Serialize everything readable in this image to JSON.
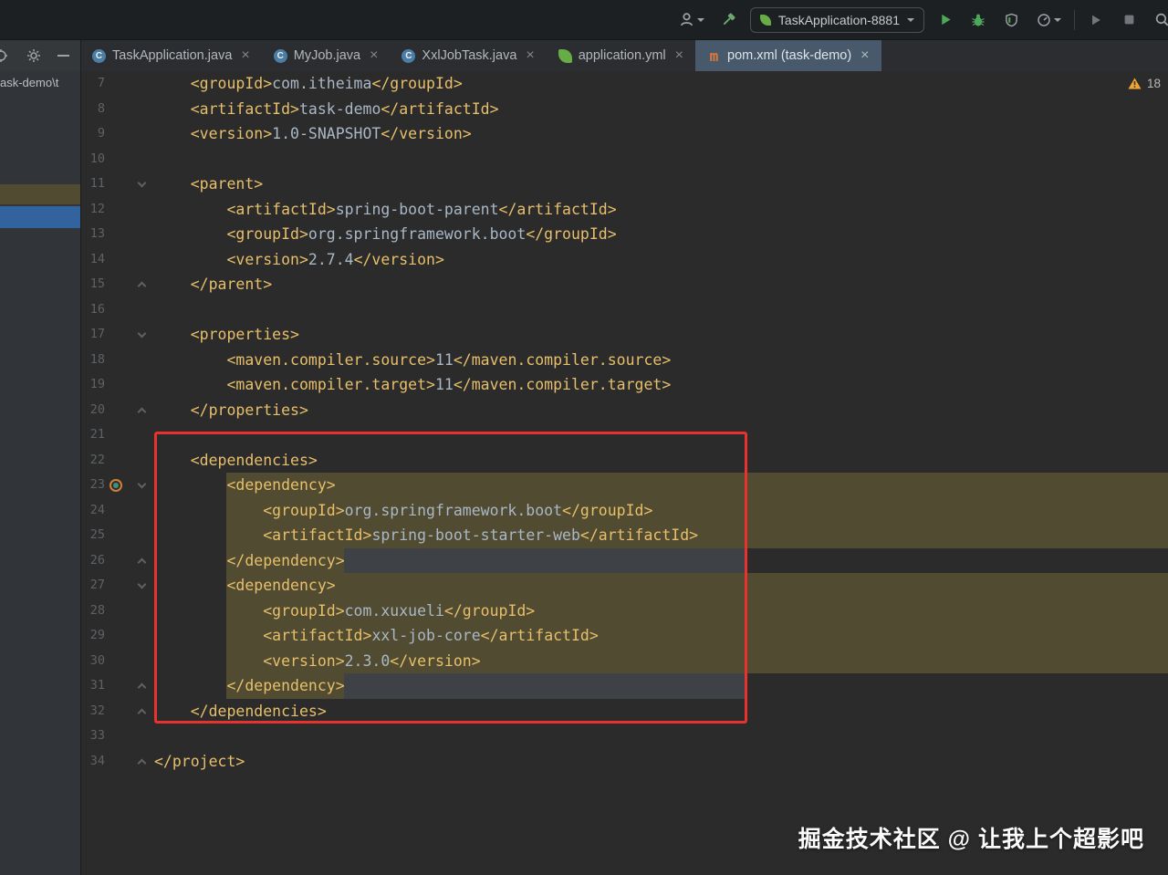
{
  "toolbar": {
    "run_config": "TaskApplication-8881"
  },
  "tabs": [
    {
      "label": "TaskApplication.java",
      "icon": "java-class",
      "active": false
    },
    {
      "label": "MyJob.java",
      "icon": "java-class",
      "active": false
    },
    {
      "label": "XxlJobTask.java",
      "icon": "java-class",
      "active": false
    },
    {
      "label": "application.yml",
      "icon": "spring-yaml",
      "active": false
    },
    {
      "label": "pom.xml (task-demo)",
      "icon": "maven",
      "active": true
    }
  ],
  "project_panel": {
    "clipped_label": "ask-demo\\t"
  },
  "inspections": {
    "warning_count": "18"
  },
  "editor": {
    "lines": [
      {
        "n": 7,
        "t": "    <groupId>com.itheima</groupId>"
      },
      {
        "n": 8,
        "t": "    <artifactId>task-demo</artifactId>"
      },
      {
        "n": 9,
        "t": "    <version>1.0-SNAPSHOT</version>"
      },
      {
        "n": 10,
        "t": ""
      },
      {
        "n": 11,
        "t": "    <parent>"
      },
      {
        "n": 12,
        "t": "        <artifactId>spring-boot-parent</artifactId>"
      },
      {
        "n": 13,
        "t": "        <groupId>org.springframework.boot</groupId>"
      },
      {
        "n": 14,
        "t": "        <version>2.7.4</version>"
      },
      {
        "n": 15,
        "t": "    </parent>"
      },
      {
        "n": 16,
        "t": ""
      },
      {
        "n": 17,
        "t": "    <properties>"
      },
      {
        "n": 18,
        "t": "        <maven.compiler.source>11</maven.compiler.source>"
      },
      {
        "n": 19,
        "t": "        <maven.compiler.target>11</maven.compiler.target>"
      },
      {
        "n": 20,
        "t": "    </properties>"
      },
      {
        "n": 21,
        "t": ""
      },
      {
        "n": 22,
        "t": "    <dependencies>"
      },
      {
        "n": 23,
        "t": "        <dependency>"
      },
      {
        "n": 24,
        "t": "            <groupId>org.springframework.boot</groupId>"
      },
      {
        "n": 25,
        "t": "            <artifactId>spring-boot-starter-web</artifactId>"
      },
      {
        "n": 26,
        "t": "        </dependency>"
      },
      {
        "n": 27,
        "t": "        <dependency>"
      },
      {
        "n": 28,
        "t": "            <groupId>com.xuxueli</groupId>"
      },
      {
        "n": 29,
        "t": "            <artifactId>xxl-job-core</artifactId>"
      },
      {
        "n": 30,
        "t": "            <version>2.3.0</version>"
      },
      {
        "n": 31,
        "t": "        </dependency>"
      },
      {
        "n": 32,
        "t": "    </dependencies>"
      },
      {
        "n": 33,
        "t": ""
      },
      {
        "n": 34,
        "t": "</project>"
      }
    ],
    "fold_start": [
      11,
      17,
      23,
      27
    ],
    "fold_end": [
      15,
      20,
      26,
      31,
      32,
      34
    ],
    "highlight_full": [
      23,
      24,
      25,
      27,
      28,
      29,
      30
    ],
    "highlight_partial": [
      26,
      31
    ],
    "icon_line": 23,
    "colors": {
      "tag": "#e8bf6a",
      "text": "#a9b7c6",
      "highlight": "#514c31",
      "highlight_gray": "#3e4145",
      "annotation_box": "#e8322e",
      "selection_blue": "#33639f"
    }
  },
  "ui": {
    "close_glyph": "×",
    "class_letter": "C",
    "maven_letter": "m"
  },
  "watermark": "掘金技术社区 @ 让我上个超影吧"
}
